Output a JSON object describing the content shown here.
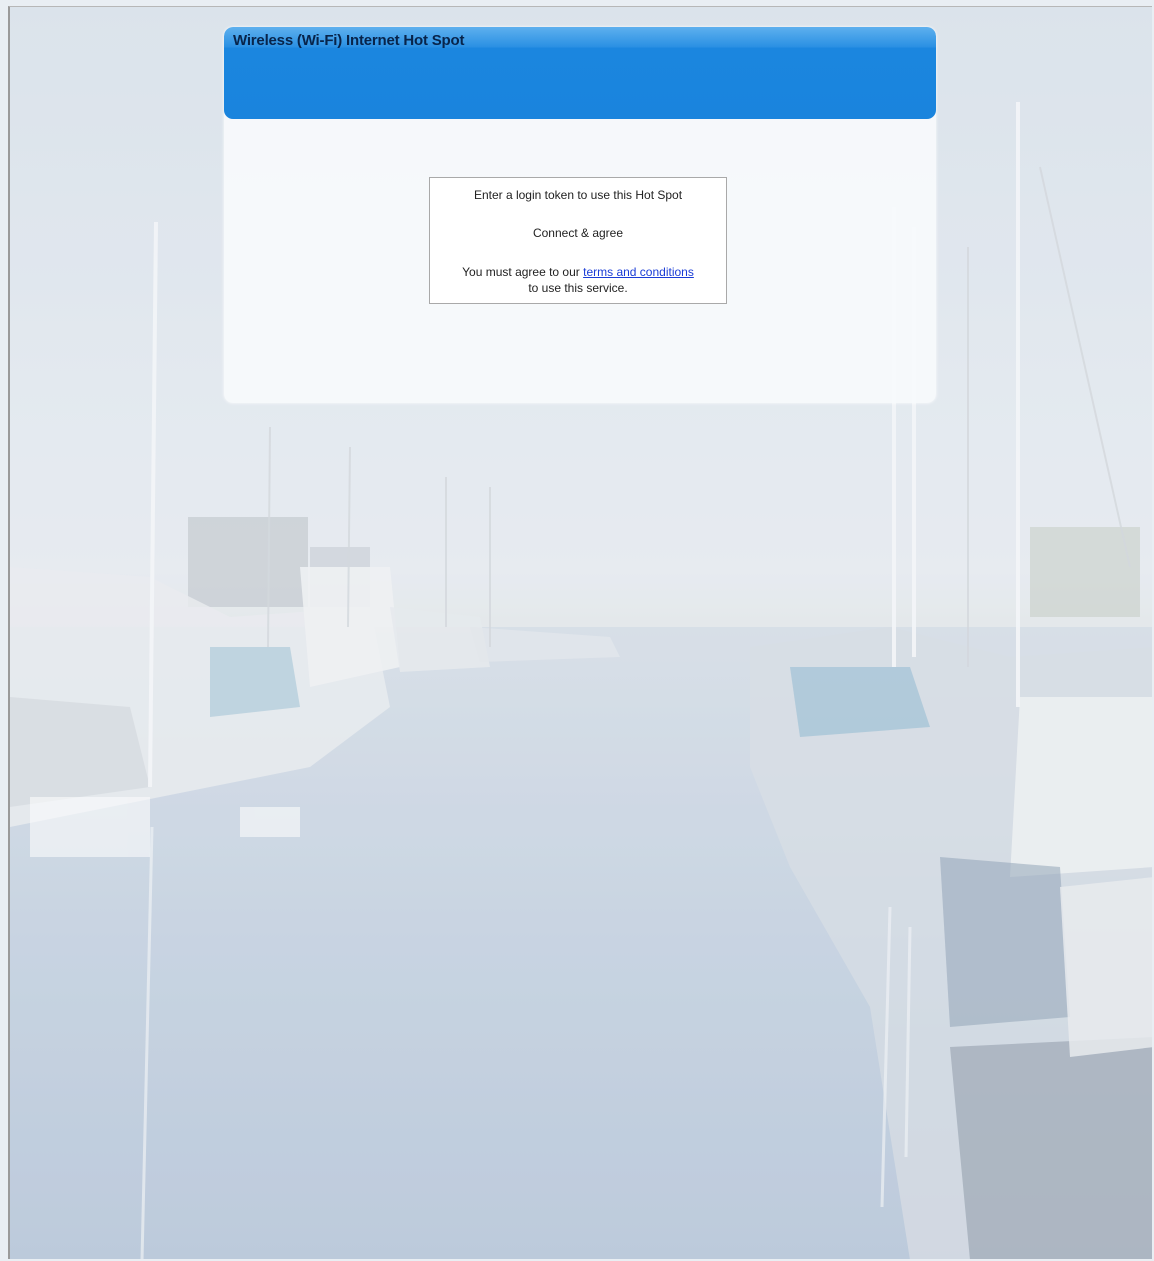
{
  "header": {
    "title": "Wireless (Wi-Fi) Internet Hot Spot"
  },
  "login": {
    "prompt": "Enter a login token to use this Hot Spot",
    "connect_label": "Connect & agree",
    "terms_prefix": "You must agree to our ",
    "terms_link_text": "terms and conditions",
    "terms_suffix": "to use this service."
  },
  "colors": {
    "header_blue": "#1a84dd",
    "title_text": "#08244a",
    "link": "#1a3cd6"
  }
}
